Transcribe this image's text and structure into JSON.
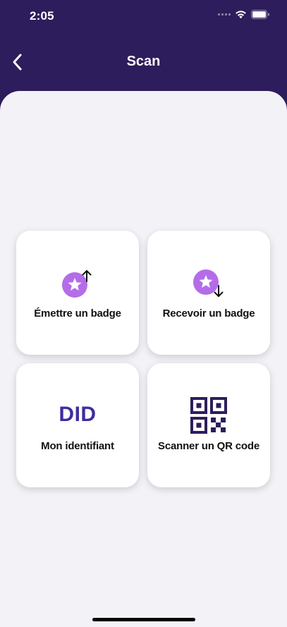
{
  "status_bar": {
    "time": "2:05"
  },
  "header": {
    "title": "Scan"
  },
  "tiles": {
    "emit_badge": {
      "label": "Émettre un badge",
      "icon": "badge-upload-icon"
    },
    "receive_badge": {
      "label": "Recevoir un badge",
      "icon": "badge-download-icon"
    },
    "identifier": {
      "label": "Mon identifiant",
      "icon_text": "DID"
    },
    "scan_qr": {
      "label": "Scanner un QR code",
      "icon": "qr-code-icon"
    }
  },
  "colors": {
    "header_bg": "#2e1d5c",
    "sheet_bg": "#f3f2f7",
    "badge_accent": "#b46de8",
    "did_text": "#3d2ea0",
    "qr_color": "#2e1d5c"
  }
}
